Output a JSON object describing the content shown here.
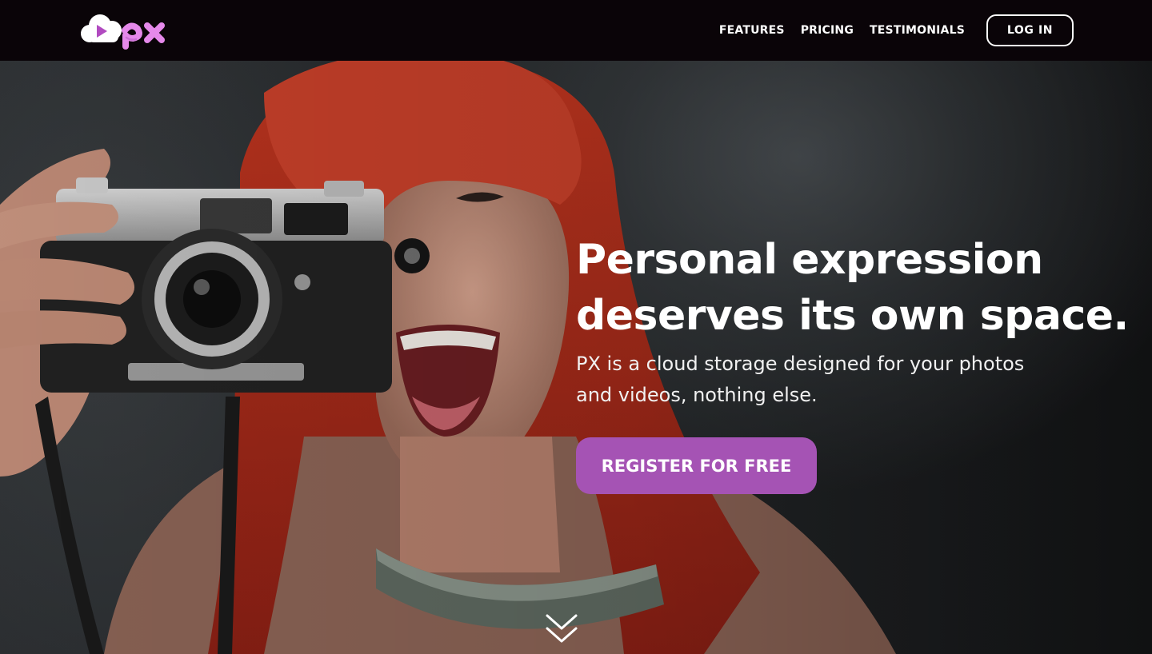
{
  "brand": {
    "logo_text": "px",
    "colors": {
      "accent": "#a553b4",
      "nav_background": "#0a0408",
      "logo_pink": "#e589ea"
    }
  },
  "nav": {
    "links": [
      {
        "label": "FEATURES"
      },
      {
        "label": "PRICING"
      },
      {
        "label": "TESTIMONIALS"
      }
    ],
    "login_label": "LOG IN"
  },
  "hero": {
    "title_line1": "Personal expression",
    "title_line2": "deserves its own space.",
    "subtitle_line1": "PX is a cloud storage designed for your photos",
    "subtitle_line2": "and videos, nothing else.",
    "cta_label": "REGISTER FOR FREE",
    "scroll_icon": "double-chevron-down-icon"
  }
}
